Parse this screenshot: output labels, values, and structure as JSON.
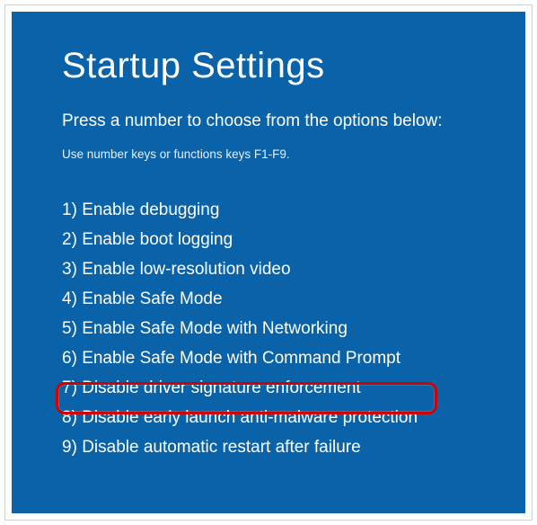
{
  "title": "Startup Settings",
  "subtitle": "Press a number to choose from the options below:",
  "hint": "Use number keys or functions keys F1-F9.",
  "options": [
    {
      "num": "1)",
      "label": "Enable debugging"
    },
    {
      "num": "2)",
      "label": "Enable boot logging"
    },
    {
      "num": "3)",
      "label": "Enable low-resolution video"
    },
    {
      "num": "4)",
      "label": "Enable Safe Mode"
    },
    {
      "num": "5)",
      "label": "Enable Safe Mode with Networking"
    },
    {
      "num": "6)",
      "label": "Enable Safe Mode with Command Prompt"
    },
    {
      "num": "7)",
      "label": "Disable driver signature enforcement"
    },
    {
      "num": "8)",
      "label": "Disable early launch anti-malware protection"
    },
    {
      "num": "9)",
      "label": "Disable automatic restart after failure"
    }
  ],
  "highlight_index": 7
}
